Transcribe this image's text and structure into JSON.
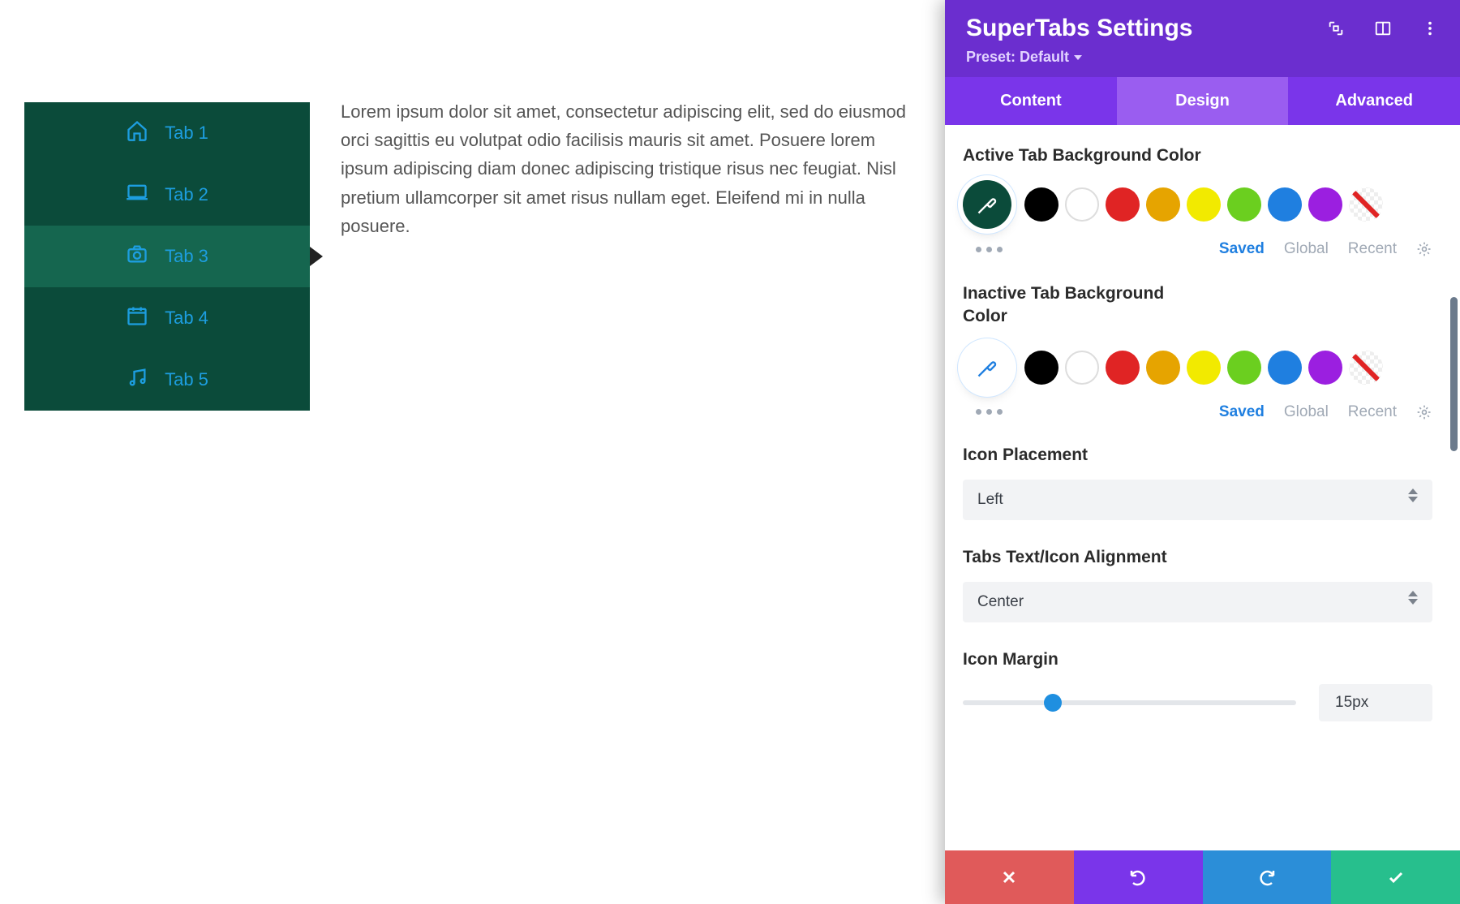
{
  "demo": {
    "tabs": [
      {
        "label": "Tab 1",
        "icon": "home-icon"
      },
      {
        "label": "Tab 2",
        "icon": "laptop-icon"
      },
      {
        "label": "Tab 3",
        "icon": "camera-icon"
      },
      {
        "label": "Tab 4",
        "icon": "calendar-icon"
      },
      {
        "label": "Tab 5",
        "icon": "music-icon"
      }
    ],
    "active_index": 2,
    "active_bg": "#15664f",
    "inactive_bg": "#0b4b3a",
    "accent": "#1d9ee0",
    "content_text": "Lorem ipsum dolor sit amet, consectetur adipiscing elit, sed do eiusmod orci sagittis eu volutpat odio facilisis mauris sit amet. Posuere lorem ipsum adipiscing diam donec adipiscing tristique risus nec feugiat. Nisl pretium ullamcorper sit amet risus nullam eget. Eleifend mi in nulla posuere."
  },
  "panel": {
    "title": "SuperTabs Settings",
    "preset_label": "Preset: Default",
    "tabs": [
      "Content",
      "Design",
      "Advanced"
    ],
    "active_tab": 1,
    "fields": {
      "active_bg_label": "Active Tab Background Color",
      "active_bg_value": "#0b4b3a",
      "inactive_bg_label": "Inactive Tab Background Color",
      "inactive_bg_value": "#ffffff",
      "color_palette": [
        "#000000",
        "#ffffff",
        "#e02424",
        "#e6a400",
        "#f2ea00",
        "#6bcf1f",
        "#1f7fe0",
        "#9b1fe0",
        "transparent"
      ],
      "palette_filters": {
        "saved": "Saved",
        "global": "Global",
        "recent": "Recent"
      },
      "icon_placement_label": "Icon Placement",
      "icon_placement_value": "Left",
      "text_align_label": "Tabs Text/Icon Alignment",
      "text_align_value": "Center",
      "icon_margin_label": "Icon Margin",
      "icon_margin_value": "15px"
    }
  }
}
